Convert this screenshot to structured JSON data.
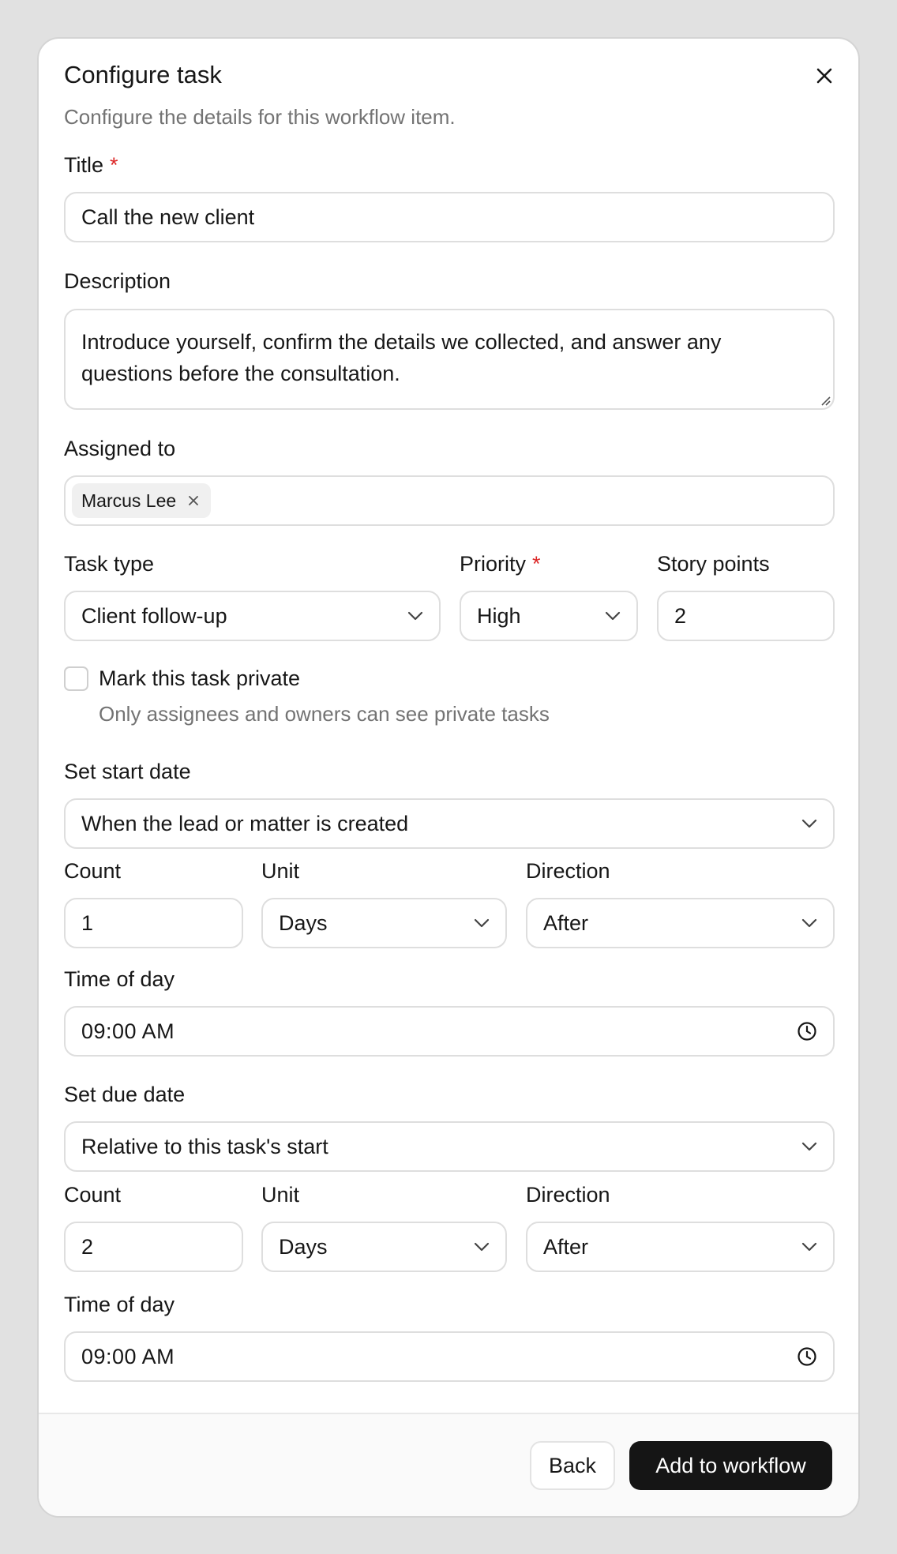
{
  "dialog": {
    "title": "Configure task",
    "subtitle": "Configure the details for this workflow item."
  },
  "form": {
    "title": {
      "label": "Title",
      "required_mark": "*",
      "value": "Call the new client"
    },
    "description": {
      "label": "Description",
      "value": "Introduce yourself, confirm the details we collected, and answer any questions before the consultation."
    },
    "assigned_to": {
      "label": "Assigned to",
      "chips": [
        "Marcus Lee"
      ]
    },
    "task_type": {
      "label": "Task type",
      "value": "Client follow-up"
    },
    "priority": {
      "label": "Priority",
      "required_mark": "*",
      "value": "High"
    },
    "story_points": {
      "label": "Story points",
      "value": "2"
    },
    "private": {
      "label": "Mark this task private",
      "help": "Only assignees and owners can see private tasks",
      "checked": false
    },
    "start_date": {
      "label": "Set start date",
      "value": "When the lead or matter is created",
      "count_label": "Count",
      "count": "1",
      "unit_label": "Unit",
      "unit": "Days",
      "direction_label": "Direction",
      "direction": "After",
      "time_label": "Time of day",
      "time": "09:00 AM"
    },
    "due_date": {
      "label": "Set due date",
      "value": "Relative to this task's start",
      "count_label": "Count",
      "count": "2",
      "unit_label": "Unit",
      "unit": "Days",
      "direction_label": "Direction",
      "direction": "After",
      "time_label": "Time of day",
      "time": "09:00 AM"
    }
  },
  "footer": {
    "back_label": "Back",
    "submit_label": "Add to workflow"
  },
  "colors": {
    "background": "#e1e1e1",
    "primary_button": "#151515",
    "required": "#dc2626",
    "muted_text": "#737373"
  },
  "icons": {
    "close": "close-icon",
    "chevron": "chevron-down-icon",
    "clock": "clock-icon",
    "chip_remove": "remove-chip-icon"
  }
}
